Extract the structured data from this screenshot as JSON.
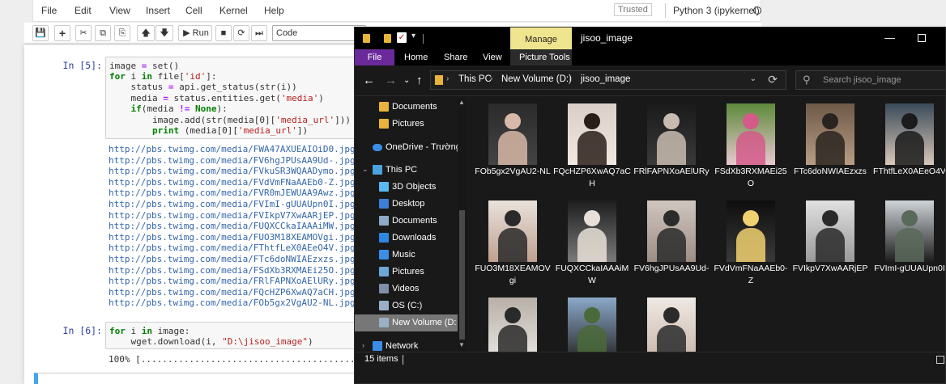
{
  "jupyter": {
    "menu": [
      "File",
      "Edit",
      "View",
      "Insert",
      "Cell",
      "Kernel",
      "Help"
    ],
    "trusted": "Trusted",
    "kernel": "Python 3 (ipykernel)",
    "toolbar": {
      "run_label": "Run",
      "cell_type": "Code"
    },
    "cell5": {
      "prompt": "In [5]:",
      "code": [
        "image = set()",
        "for i in file['id']:",
        "    status = api.get_status(str(i))",
        "    media = status.entities.get('media')",
        "    if(media != None):",
        "        image.add(str(media[0]['media_url']))",
        "        print (media[0]['media_url'])"
      ],
      "output": [
        "http://pbs.twimg.com/media/FWA47AXUEAIOiD0.jpg",
        "http://pbs.twimg.com/media/FV6hgJPUsAA9Ud-.jpg",
        "http://pbs.twimg.com/media/FVkuSR3WQAADymo.jpg",
        "http://pbs.twimg.com/media/FVdVmFNaAAEb0-Z.jpg",
        "http://pbs.twimg.com/media/FVR0mJEWUAA9Awz.jpg",
        "http://pbs.twimg.com/media/FVImI-gUUAUpn0I.jpg",
        "http://pbs.twimg.com/media/FVIkpV7XwAARjEP.jpg",
        "http://pbs.twimg.com/media/FUQXCCkaIAAAiMW.jpg",
        "http://pbs.twimg.com/media/FUO3M18XEAMOVgi.jpg",
        "http://pbs.twimg.com/media/FThtfLeX0AEeO4V.jpg",
        "http://pbs.twimg.com/media/FTc6doNWIAEzxzs.jpg",
        "http://pbs.twimg.com/media/FSdXb3RXMAEi25O.jpg",
        "http://pbs.twimg.com/media/FRlFAPNXoAElURy.jpg",
        "http://pbs.twimg.com/media/FQcHZP6XwAQ7aCH.jpg",
        "http://pbs.twimg.com/media/FOb5gx2VgAU2-NL.jpg"
      ]
    },
    "cell6": {
      "prompt": "In [6]:",
      "code": [
        "for i in image:",
        "    wget.download(i, \"D:\\jisoo_image\")"
      ],
      "progress": "100% [............................................"
    }
  },
  "explorer": {
    "window_title": "jisoo_image",
    "manage_tab": "Manage",
    "ribbon_tabs": [
      "File",
      "Home",
      "Share",
      "View",
      "Picture Tools"
    ],
    "breadcrumb": [
      "This PC",
      "New Volume (D:)",
      "jisoo_image"
    ],
    "search_placeholder": "Search jisoo_image",
    "nav_items": [
      {
        "label": "Documents",
        "icon": "folder-icon"
      },
      {
        "label": "Pictures",
        "icon": "folder-icon"
      },
      {
        "label": "OneDrive - Trường",
        "icon": "cloud-icon"
      },
      {
        "label": "This PC",
        "icon": "computer-icon"
      },
      {
        "label": "3D Objects",
        "icon": "cube-icon"
      },
      {
        "label": "Desktop",
        "icon": "desktop-icon"
      },
      {
        "label": "Documents",
        "icon": "documents-icon"
      },
      {
        "label": "Downloads",
        "icon": "download-icon"
      },
      {
        "label": "Music",
        "icon": "music-icon"
      },
      {
        "label": "Pictures",
        "icon": "pictures-icon"
      },
      {
        "label": "Videos",
        "icon": "video-icon"
      },
      {
        "label": "OS (C:)",
        "icon": "drive-icon"
      },
      {
        "label": "New Volume (D:",
        "icon": "drive-icon"
      },
      {
        "label": "Network",
        "icon": "network-icon"
      }
    ],
    "files": [
      "FOb5gx2VgAU2-NL",
      "FQcHZP6XwAQ7aCH",
      "FRlFAPNXoAElURy",
      "FSdXb3RXMAEi25O",
      "FTc6doNWIAEzxzs",
      "FThtfLeX0AEeO4V",
      "FUO3M18XEAMOVgi",
      "FUQXCCkaIAAAiMW",
      "FV6hgJPUsAA9Ud-",
      "FVdVmFNaAAEb0-Z",
      "FVIkpV7XwAARjEP",
      "FVImI-gUUAUpn0I",
      "",
      "",
      ""
    ],
    "status_text": "15 items",
    "colors": {
      "accent": "#6b2a9b",
      "manage": "#f0e58f",
      "folder": "#e8b43a"
    }
  }
}
